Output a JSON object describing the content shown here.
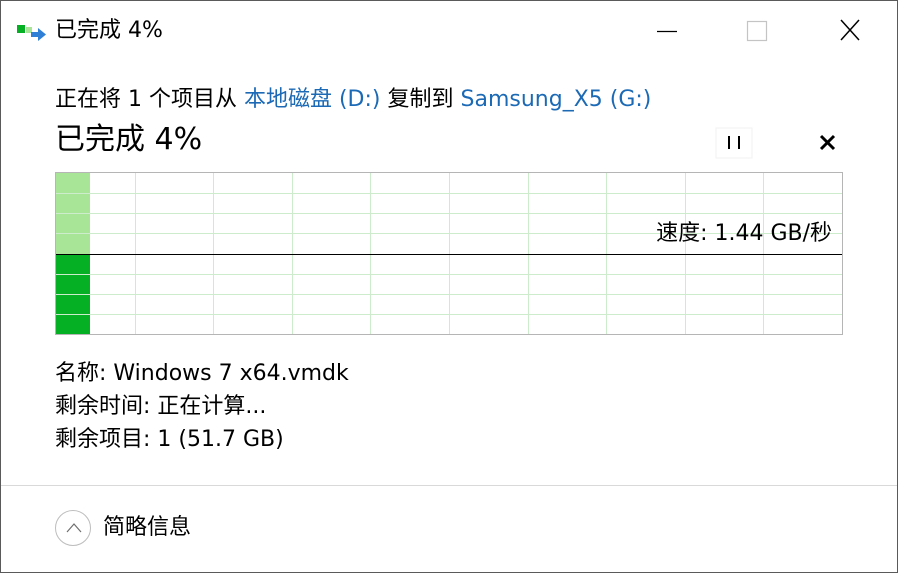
{
  "window": {
    "title": "已完成 4%",
    "icon": "copy-transfer-icon"
  },
  "copy": {
    "prefix": "正在将 1 个项目从 ",
    "source": "本地磁盘 (D:)",
    "middle": " 复制到 ",
    "destination": "Samsung_X5 (G:)",
    "link_color": "#1c6ab6"
  },
  "progress": {
    "title": "已完成 4%",
    "fraction": 0.04,
    "speed": "速度: 1.44 GB/秒",
    "fill_color": "#06b025",
    "fill_light_color": "#a9e597",
    "grid_color": "#cdeccb"
  },
  "details": {
    "name": "名称: Windows 7 x64.vmdk",
    "time_remaining": "剩余时间: 正在计算...",
    "items_remaining": "剩余项目: 1 (51.7 GB)"
  },
  "footer": {
    "toggle_label": "简略信息"
  }
}
